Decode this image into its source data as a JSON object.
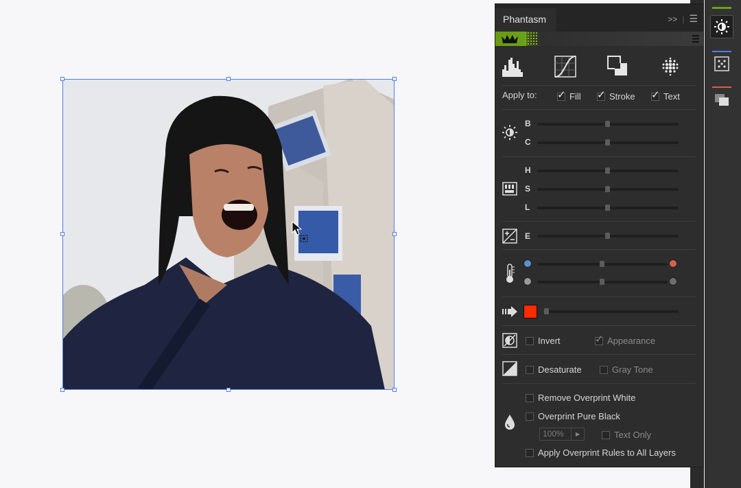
{
  "panel": {
    "title": "Phantasm",
    "apply_to": {
      "label": "Apply to:",
      "fill": {
        "label": "Fill",
        "checked": true
      },
      "stroke": {
        "label": "Stroke",
        "checked": true
      },
      "text": {
        "label": "Text",
        "checked": true
      }
    },
    "brightness": {
      "b_label": "B",
      "c_label": "C",
      "b_value": 0.5,
      "c_value": 0.5
    },
    "hsl": {
      "h_label": "H",
      "s_label": "S",
      "l_label": "L",
      "h_value": 0.5,
      "s_value": 0.5,
      "l_value": 0.5
    },
    "exposure": {
      "e_label": "E",
      "e_value": 0.5
    },
    "temperature": {
      "left_colors": [
        "#5b8fd6",
        "#9a9a9a"
      ],
      "right_colors": [
        "#d9604a",
        "#6f6f6f"
      ],
      "values": [
        0.5,
        0.5
      ]
    },
    "tint": {
      "color": "#ff2a00",
      "value": 0.0
    },
    "invert": {
      "label": "Invert",
      "checked": false,
      "appearance_label": "Appearance",
      "appearance_checked": true
    },
    "desaturate": {
      "label": "Desaturate",
      "checked": false,
      "gray_tone_label": "Gray Tone",
      "gray_tone_checked": false
    },
    "overprint": {
      "remove_white": "Remove Overprint White",
      "pure_black": "Overprint Pure Black",
      "percent": "100%",
      "text_only": "Text Only",
      "all_layers": "Apply Overprint Rules to All Layers"
    }
  },
  "colors": {
    "accent_green": "#6aa018",
    "panel_bg": "#2d2d2d",
    "selection_blue": "#4d7fe6"
  },
  "icons": [
    "histogram-icon",
    "curves-icon",
    "halftone-icon",
    "brightness-icon",
    "hsl-icon",
    "exposure-icon",
    "temperature-icon",
    "tint-icon",
    "invert-icon",
    "desaturate-icon",
    "ink-drop-icon",
    "crown-icon"
  ]
}
